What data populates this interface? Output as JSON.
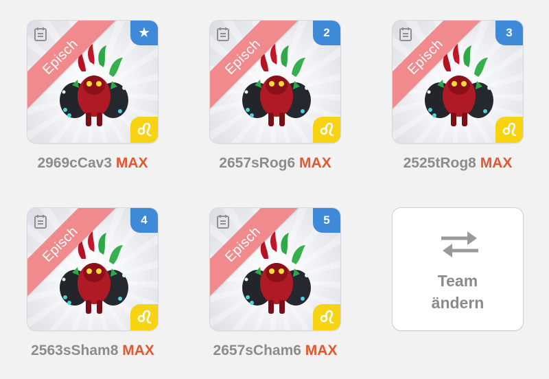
{
  "monsters": [
    {
      "rarity": "Episch",
      "badge": "★",
      "badge_type": "star",
      "name": "2969cCav3",
      "level": "MAX"
    },
    {
      "rarity": "Episch",
      "badge": "2",
      "badge_type": "number",
      "name": "2657sRog6",
      "level": "MAX"
    },
    {
      "rarity": "Episch",
      "badge": "3",
      "badge_type": "number",
      "name": "2525tRog8",
      "level": "MAX"
    },
    {
      "rarity": "Episch",
      "badge": "4",
      "badge_type": "number",
      "name": "2563sSham8",
      "level": "MAX"
    },
    {
      "rarity": "Episch",
      "badge": "5",
      "badge_type": "number",
      "name": "2657sCham6",
      "level": "MAX"
    }
  ],
  "team_button": {
    "line1": "Team",
    "line2": "ändern",
    "icon": "swap-arrows-icon"
  },
  "colors": {
    "rarity_ribbon": "#f08a8c",
    "badge_blue": "#3e8ad8",
    "zodiac_yellow": "#f7d312",
    "max_orange": "#e4572e",
    "name_gray": "#8c8c8c"
  }
}
